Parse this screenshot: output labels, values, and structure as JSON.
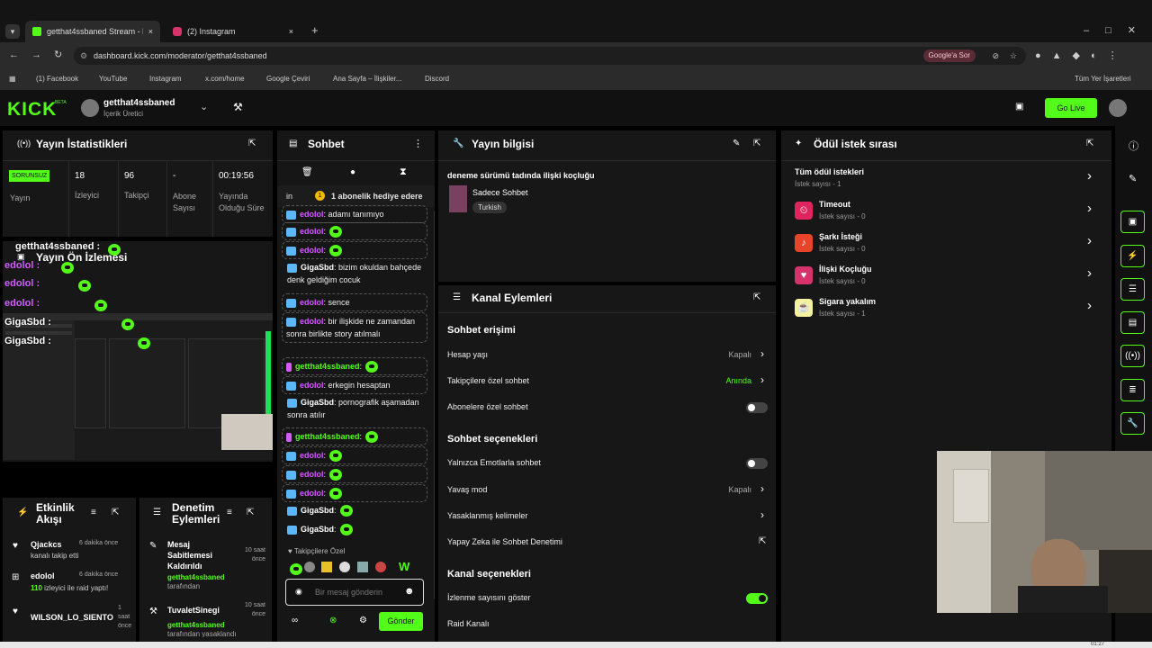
{
  "browser": {
    "tabs": [
      {
        "title": "getthat4ssbaned Stream - Kick",
        "close": "×"
      },
      {
        "title": "(2) Instagram",
        "close": "×"
      }
    ],
    "new_tab": "+",
    "url": "dashboard.kick.com/moderator/getthat4ssbaned",
    "ask_google": "Google'a Sor",
    "bookmarks": [
      "(1) Facebook",
      "YouTube",
      "Instagram",
      "x.com/home",
      "Google Çeviri",
      "Ana Sayfa – İlişkiler...",
      "Discord"
    ],
    "all_bookmarks": "Tüm Yer İşaretleri"
  },
  "header": {
    "logo": "KICK",
    "beta": "BETA",
    "channel_name": "getthat4ssbaned",
    "role": "İçerik Üretici",
    "go_live": "Go Live"
  },
  "stats": {
    "title": "Yayın İstatistikleri",
    "status_badge": "SORUNSUZ",
    "cells": [
      {
        "value": "",
        "label": "Yayın"
      },
      {
        "value": "18",
        "label": "İzleyici"
      },
      {
        "value": "96",
        "label": "Takipçi"
      },
      {
        "value": "-",
        "label": "Abone Sayısı"
      },
      {
        "value": "00:19:56",
        "label": "Yayında Olduğu Süre"
      }
    ]
  },
  "preview": {
    "title": "Yayın Ön İzlemesi",
    "overlay_names": [
      "getthat4ssbaned :",
      "edolol :",
      "edolol :",
      "edolol :",
      "GigaSbd :",
      "GigaSbd :"
    ]
  },
  "activity": {
    "title": "Etkinlik Akışı",
    "items": [
      {
        "name": "Qjackcs",
        "time": "6 dakika önce",
        "desc": "kanalı takip etti"
      },
      {
        "name": "edolol",
        "time": "6 dakika önce",
        "desc_green": "110",
        "desc": "izleyici ile raid yaptı!"
      },
      {
        "name": "WILSON_LO_SIENTO",
        "time": "1 saat önce",
        "desc": ""
      }
    ]
  },
  "moderation": {
    "title": "Denetim Eylemleri",
    "items": [
      {
        "action": "Mesaj Sabitlemesi Kaldırıldı",
        "user": "getthat4ssbaned",
        "by": "tarafından",
        "time": "10 saat önce"
      },
      {
        "action": "TuvaletSinegi",
        "user": "getthat4ssbaned",
        "by": "tarafından yasaklandı",
        "time": "10 saat önce"
      }
    ]
  },
  "chat": {
    "title": "Sohbet",
    "pinned_prefix": "in",
    "pinned_text": "1 abonelik hediye edere",
    "messages": [
      {
        "user": "edolol",
        "text": ": adamı tanımıyo",
        "type": "box"
      },
      {
        "user": "edolol",
        "text": ":",
        "emote": true,
        "type": "box"
      },
      {
        "user": "edolol",
        "text": ":",
        "emote": true,
        "type": "box"
      },
      {
        "user": "GigaSbd",
        "text": ": bizim okuldan bahçede denk geldiğim cocuk",
        "type": "plain"
      },
      {
        "user": "edolol",
        "text": ": sence",
        "type": "box"
      },
      {
        "user": "edolol",
        "text": ": bir ilişkide ne zamandan sonra birlikte story atılmalı",
        "type": "box"
      },
      {
        "user": "getthat4ssbaned",
        "text": ":",
        "emote": true,
        "type": "box"
      },
      {
        "user": "edolol",
        "text": ": erkegin hesaptan",
        "type": "box"
      },
      {
        "user": "GigaSbd",
        "text": ": pornografik aşamadan sonra atılır",
        "type": "plain"
      },
      {
        "user": "getthat4ssbaned",
        "text": ":",
        "emote": true,
        "type": "box"
      },
      {
        "user": "edolol",
        "text": ":",
        "emote": true,
        "type": "box"
      },
      {
        "user": "edolol",
        "text": ":",
        "emote": true,
        "type": "box"
      },
      {
        "user": "edolol",
        "text": ":",
        "emote": true,
        "type": "box"
      },
      {
        "user": "GigaSbd",
        "text": ":",
        "emote": true,
        "type": "plain"
      },
      {
        "user": "GigaSbd",
        "text": ":",
        "emote": true,
        "type": "plain"
      }
    ],
    "followers_only_label": "Takipçilere Özel",
    "input_placeholder": "Bir mesaj gönderin",
    "send_label": "Gönder"
  },
  "stream_info": {
    "title": "Yayın bilgisi",
    "stream_title": "deneme sürümü tadında ilişki koçluğu",
    "category": "Sadece Sohbet",
    "tag": "Turkish"
  },
  "channel_actions": {
    "title": "Kanal Eylemleri",
    "sections": [
      {
        "heading": "Sohbet erişimi",
        "rows": [
          {
            "label": "Hesap yaşı",
            "value": "Kapalı",
            "control": "chevron"
          },
          {
            "label": "Takipçilere özel sohbet",
            "value": "Anında",
            "control": "chevron"
          },
          {
            "label": "Abonelere özel sohbet",
            "value": "",
            "control": "toggle-off"
          }
        ]
      },
      {
        "heading": "Sohbet seçenekleri",
        "rows": [
          {
            "label": "Yalnızca Emotlarla sohbet",
            "value": "",
            "control": "toggle-off"
          },
          {
            "label": "Yavaş mod",
            "value": "Kapalı",
            "control": "chevron"
          },
          {
            "label": "Yasaklanmış kelimeler",
            "value": "",
            "control": "chevron"
          },
          {
            "label": "Yapay Zeka ile Sohbet Denetimi",
            "value": "",
            "control": "external"
          }
        ]
      },
      {
        "heading": "Kanal seçenekleri",
        "rows": [
          {
            "label": "İzlenme sayısını göster",
            "value": "",
            "control": "toggle-on"
          },
          {
            "label": "Raid Kanalı",
            "value": "",
            "control": "none"
          }
        ]
      }
    ]
  },
  "rewards": {
    "title": "Ödül istek sırası",
    "items": [
      {
        "name": "Tüm ödül istekleri",
        "count": "İstek sayısı - 1",
        "color": ""
      },
      {
        "name": "Timeout",
        "count": "İstek sayısı - 0",
        "color": "#e0245e"
      },
      {
        "name": "Şarkı İsteği",
        "count": "İstek sayısı - 0",
        "color": "#e8442a"
      },
      {
        "name": "İlişki Koçluğu",
        "count": "İstek sayısı - 0",
        "color": "#d6336c"
      },
      {
        "name": "Sigara yakalım",
        "count": "İstek sayısı - 1",
        "color": "#f4f1a0"
      }
    ]
  },
  "taskbar_clock": "01:27"
}
